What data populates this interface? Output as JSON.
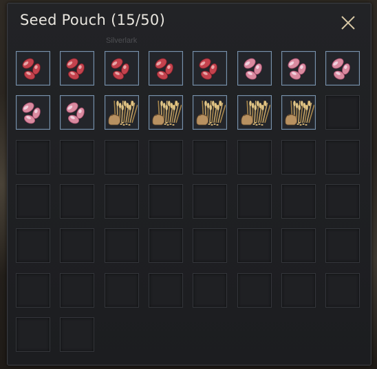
{
  "window": {
    "title": "Seed Pouch (15/50)",
    "background_label": "Silverlark",
    "close_icon": "close-icon"
  },
  "inventory": {
    "capacity": 50,
    "used": 15,
    "slots": [
      {
        "item": "red-bean-seed",
        "icon": "red-bean-seed-icon"
      },
      {
        "item": "red-bean-seed",
        "icon": "red-bean-seed-icon"
      },
      {
        "item": "red-bean-seed",
        "icon": "red-bean-seed-icon"
      },
      {
        "item": "red-bean-seed",
        "icon": "red-bean-seed-icon"
      },
      {
        "item": "red-bean-seed",
        "icon": "red-bean-seed-icon"
      },
      {
        "item": "pink-bean-seed",
        "icon": "pink-bean-seed-icon"
      },
      {
        "item": "pink-bean-seed",
        "icon": "pink-bean-seed-icon"
      },
      {
        "item": "pink-bean-seed",
        "icon": "pink-bean-seed-icon"
      },
      {
        "item": "pink-bean-seed",
        "icon": "pink-bean-seed-icon"
      },
      {
        "item": "pink-bean-seed",
        "icon": "pink-bean-seed-icon"
      },
      {
        "item": "grain-sack",
        "icon": "grain-sack-icon"
      },
      {
        "item": "grain-sack",
        "icon": "grain-sack-icon"
      },
      {
        "item": "grain-sack",
        "icon": "grain-sack-icon"
      },
      {
        "item": "grain-sack",
        "icon": "grain-sack-icon"
      },
      {
        "item": "grain-sack",
        "icon": "grain-sack-icon"
      }
    ]
  },
  "colors": {
    "filled_border": "#7a93ad",
    "empty_border": "#34363b",
    "title_text": "#e9e6df"
  }
}
